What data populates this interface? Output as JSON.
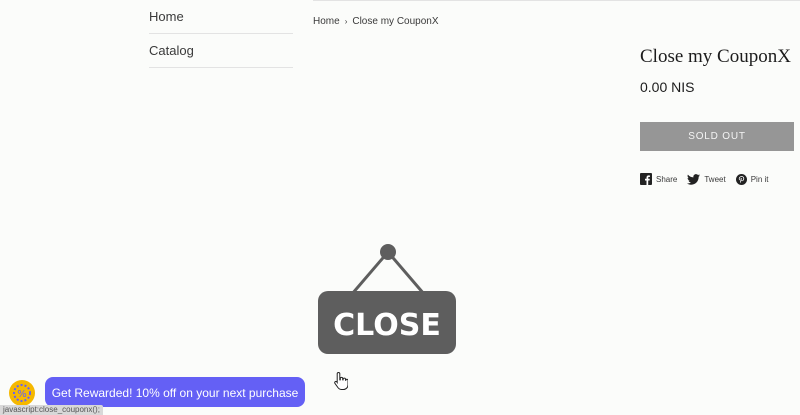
{
  "sidebar": {
    "items": [
      {
        "label": "Home"
      },
      {
        "label": "Catalog"
      }
    ]
  },
  "breadcrumb": {
    "home": "Home",
    "separator": "›",
    "current": "Close my CouponX"
  },
  "product": {
    "title": "Close my CouponX",
    "price": "0.00 NIS",
    "button_label": "SOLD OUT"
  },
  "share": {
    "facebook": "Share",
    "twitter": "Tweet",
    "pinterest": "Pin it"
  },
  "sign": {
    "text": "CLOSE"
  },
  "widget": {
    "label": "Get Rewarded! 10% off on your next purchase"
  },
  "status_bar": {
    "text": "javascript:close_couponx();"
  },
  "colors": {
    "accent": "#6460f5",
    "sign": "#5e5e5e",
    "sold_out": "#969696",
    "badge": "#f5b800"
  }
}
